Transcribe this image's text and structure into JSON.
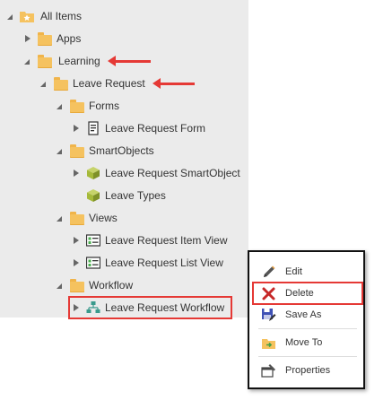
{
  "tree": {
    "root": "All Items",
    "apps": "Apps",
    "learning": "Learning",
    "leave_request": "Leave Request",
    "forms": "Forms",
    "leave_request_form": "Leave Request Form",
    "smartobjects": "SmartObjects",
    "leave_request_smartobject": "Leave Request SmartObject",
    "leave_types": "Leave Types",
    "views": "Views",
    "leave_request_item_view": "Leave Request Item View",
    "leave_request_list_view": "Leave Request List View",
    "workflow": "Workflow",
    "leave_request_workflow": "Leave Request Workflow"
  },
  "context_menu": {
    "edit": "Edit",
    "delete": "Delete",
    "save_as": "Save As",
    "move_to": "Move To",
    "properties": "Properties"
  },
  "icons": {
    "folder": "folder-icon",
    "form": "form-icon",
    "smartobject": "smartobject-cube-icon",
    "view": "view-icon",
    "workflow": "workflow-icon",
    "edit": "pencil-icon",
    "delete": "x-icon",
    "save_as": "save-as-icon",
    "move_to": "move-to-folder-icon",
    "properties": "properties-icon"
  },
  "colors": {
    "panel_bg": "#ebebeb",
    "folder": "#f5c25f",
    "highlight": "#e53935",
    "cube": "#a5b93a",
    "workflow": "#3a9a8c"
  }
}
